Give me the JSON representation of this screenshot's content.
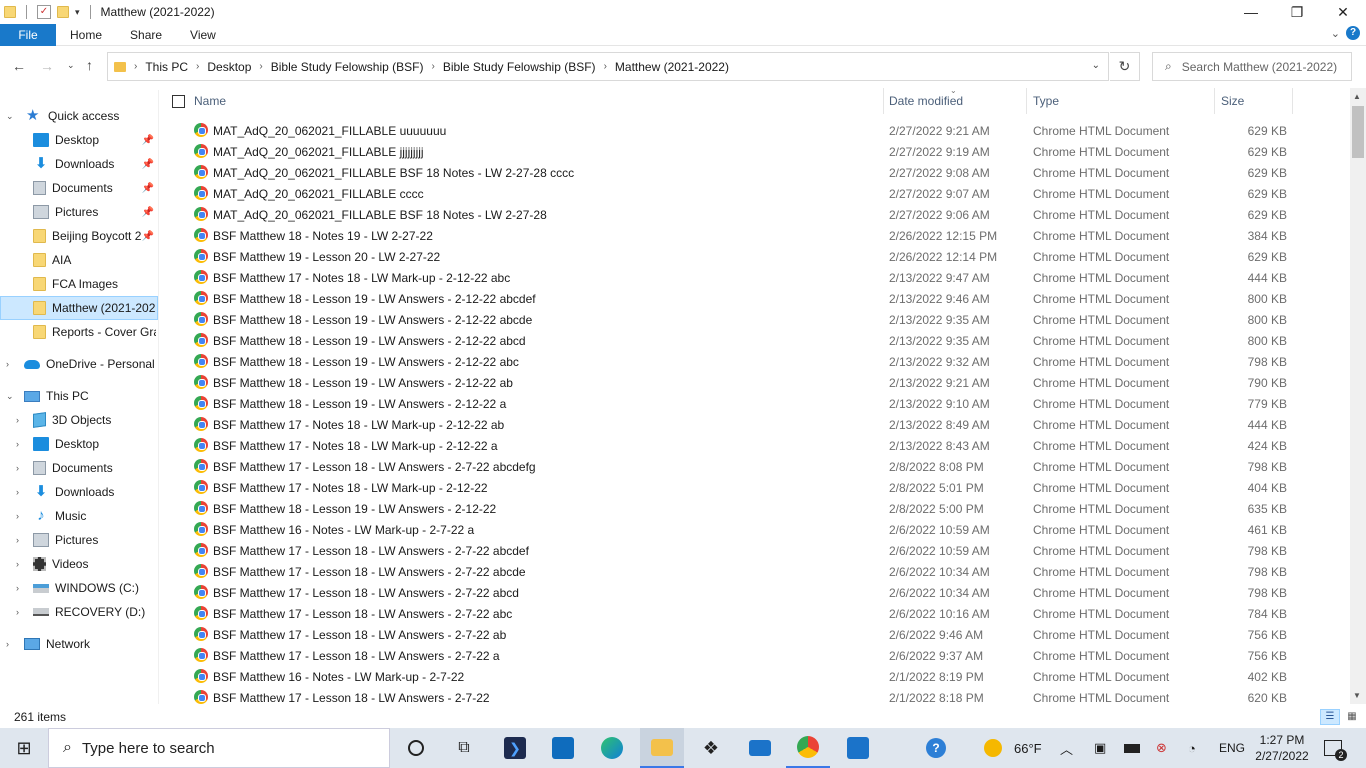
{
  "window": {
    "title": "Matthew (2021-2022)",
    "controls": [
      "—",
      "❐",
      "✕"
    ]
  },
  "ribbon": {
    "file": "File",
    "tabs": [
      "Home",
      "Share",
      "View"
    ]
  },
  "address": {
    "crumbs": [
      "This PC",
      "Desktop",
      "Bible Study Felowship (BSF)",
      "Bible Study Felowship (BSF)",
      "Matthew (2021-2022)"
    ],
    "search_placeholder": "Search Matthew (2021-2022)"
  },
  "sidebar": {
    "quick_access": "Quick access",
    "items": [
      {
        "label": "Desktop",
        "icon": "desktop-icon",
        "pinned": true
      },
      {
        "label": "Downloads",
        "icon": "download-arrow-icon",
        "pinned": true
      },
      {
        "label": "Documents",
        "icon": "documents-icon",
        "pinned": true
      },
      {
        "label": "Pictures",
        "icon": "pictures-icon",
        "pinned": true
      },
      {
        "label": "Beijing Boycott 2",
        "icon": "folder-icon",
        "pinned": true
      },
      {
        "label": "AIA",
        "icon": "folder-icon",
        "pinned": false
      },
      {
        "label": "FCA Images",
        "icon": "folder-icon",
        "pinned": false
      },
      {
        "label": "Matthew (2021-2022)",
        "icon": "folder-icon",
        "pinned": false,
        "selected": true
      },
      {
        "label": "Reports - Cover Gra",
        "icon": "folder-icon",
        "pinned": false
      }
    ],
    "onedrive": "OneDrive - Personal",
    "this_pc": "This PC",
    "pc_items": [
      {
        "label": "3D Objects",
        "icon": "3d-objects-icon"
      },
      {
        "label": "Desktop",
        "icon": "desktop-icon"
      },
      {
        "label": "Documents",
        "icon": "documents-icon"
      },
      {
        "label": "Downloads",
        "icon": "download-arrow-icon"
      },
      {
        "label": "Music",
        "icon": "music-icon"
      },
      {
        "label": "Pictures",
        "icon": "pictures-icon"
      },
      {
        "label": "Videos",
        "icon": "videos-icon"
      },
      {
        "label": "WINDOWS (C:)",
        "icon": "windows-drive-icon"
      },
      {
        "label": "RECOVERY (D:)",
        "icon": "drive-icon"
      }
    ],
    "network": "Network"
  },
  "columns": {
    "name": "Name",
    "date": "Date modified",
    "type": "Type",
    "size": "Size"
  },
  "files": [
    {
      "name": "MAT_AdQ_20_062021_FILLABLE uuuuuuu",
      "date": "2/27/2022 9:21 AM",
      "type": "Chrome HTML Document",
      "size": "629 KB"
    },
    {
      "name": "MAT_AdQ_20_062021_FILLABLE jjjjjjjjj",
      "date": "2/27/2022 9:19 AM",
      "type": "Chrome HTML Document",
      "size": "629 KB"
    },
    {
      "name": "MAT_AdQ_20_062021_FILLABLE BSF 18 Notes - LW 2-27-28 cccc",
      "date": "2/27/2022 9:08 AM",
      "type": "Chrome HTML Document",
      "size": "629 KB"
    },
    {
      "name": "MAT_AdQ_20_062021_FILLABLE cccc",
      "date": "2/27/2022 9:07 AM",
      "type": "Chrome HTML Document",
      "size": "629 KB"
    },
    {
      "name": "MAT_AdQ_20_062021_FILLABLE BSF 18 Notes - LW 2-27-28",
      "date": "2/27/2022 9:06 AM",
      "type": "Chrome HTML Document",
      "size": "629 KB"
    },
    {
      "name": "BSF Matthew 18 - Notes 19 - LW 2-27-22",
      "date": "2/26/2022 12:15 PM",
      "type": "Chrome HTML Document",
      "size": "384 KB"
    },
    {
      "name": "BSF Matthew 19 - Lesson 20 - LW 2-27-22",
      "date": "2/26/2022 12:14 PM",
      "type": "Chrome HTML Document",
      "size": "629 KB"
    },
    {
      "name": "BSF Matthew 17 - Notes 18 - LW Mark-up - 2-12-22 abc",
      "date": "2/13/2022 9:47 AM",
      "type": "Chrome HTML Document",
      "size": "444 KB"
    },
    {
      "name": "BSF Matthew 18 - Lesson 19 - LW Answers - 2-12-22 abcdef",
      "date": "2/13/2022 9:46 AM",
      "type": "Chrome HTML Document",
      "size": "800 KB"
    },
    {
      "name": "BSF Matthew 18 - Lesson 19 - LW Answers - 2-12-22 abcde",
      "date": "2/13/2022 9:35 AM",
      "type": "Chrome HTML Document",
      "size": "800 KB"
    },
    {
      "name": "BSF Matthew 18 - Lesson 19 - LW Answers - 2-12-22 abcd",
      "date": "2/13/2022 9:35 AM",
      "type": "Chrome HTML Document",
      "size": "800 KB"
    },
    {
      "name": "BSF Matthew 18 - Lesson 19 - LW Answers - 2-12-22 abc",
      "date": "2/13/2022 9:32 AM",
      "type": "Chrome HTML Document",
      "size": "798 KB"
    },
    {
      "name": "BSF Matthew 18 - Lesson 19 - LW Answers - 2-12-22 ab",
      "date": "2/13/2022 9:21 AM",
      "type": "Chrome HTML Document",
      "size": "790 KB"
    },
    {
      "name": "BSF Matthew 18 - Lesson 19 - LW Answers - 2-12-22 a",
      "date": "2/13/2022 9:10 AM",
      "type": "Chrome HTML Document",
      "size": "779 KB"
    },
    {
      "name": "BSF Matthew 17 - Notes 18 - LW Mark-up - 2-12-22 ab",
      "date": "2/13/2022 8:49 AM",
      "type": "Chrome HTML Document",
      "size": "444 KB"
    },
    {
      "name": "BSF Matthew 17 - Notes 18 - LW Mark-up - 2-12-22 a",
      "date": "2/13/2022 8:43 AM",
      "type": "Chrome HTML Document",
      "size": "424 KB"
    },
    {
      "name": "BSF Matthew 17 - Lesson 18 - LW Answers - 2-7-22 abcdefg",
      "date": "2/8/2022 8:08 PM",
      "type": "Chrome HTML Document",
      "size": "798 KB"
    },
    {
      "name": "BSF Matthew 17 - Notes 18 - LW Mark-up - 2-12-22",
      "date": "2/8/2022 5:01 PM",
      "type": "Chrome HTML Document",
      "size": "404 KB"
    },
    {
      "name": "BSF Matthew 18 - Lesson 19 - LW Answers - 2-12-22",
      "date": "2/8/2022 5:00 PM",
      "type": "Chrome HTML Document",
      "size": "635 KB"
    },
    {
      "name": "BSF Matthew 16 - Notes - LW Mark-up - 2-7-22 a",
      "date": "2/6/2022 10:59 AM",
      "type": "Chrome HTML Document",
      "size": "461 KB"
    },
    {
      "name": "BSF Matthew 17 - Lesson 18 - LW Answers - 2-7-22 abcdef",
      "date": "2/6/2022 10:59 AM",
      "type": "Chrome HTML Document",
      "size": "798 KB"
    },
    {
      "name": "BSF Matthew 17 - Lesson 18 - LW Answers - 2-7-22 abcde",
      "date": "2/6/2022 10:34 AM",
      "type": "Chrome HTML Document",
      "size": "798 KB"
    },
    {
      "name": "BSF Matthew 17 - Lesson 18 - LW Answers - 2-7-22 abcd",
      "date": "2/6/2022 10:34 AM",
      "type": "Chrome HTML Document",
      "size": "798 KB"
    },
    {
      "name": "BSF Matthew 17 - Lesson 18 - LW Answers - 2-7-22 abc",
      "date": "2/6/2022 10:16 AM",
      "type": "Chrome HTML Document",
      "size": "784 KB"
    },
    {
      "name": "BSF Matthew 17 - Lesson 18 - LW Answers - 2-7-22 ab",
      "date": "2/6/2022 9:46 AM",
      "type": "Chrome HTML Document",
      "size": "756 KB"
    },
    {
      "name": "BSF Matthew 17 - Lesson 18 - LW Answers - 2-7-22 a",
      "date": "2/6/2022 9:37 AM",
      "type": "Chrome HTML Document",
      "size": "756 KB"
    },
    {
      "name": "BSF Matthew 16 - Notes - LW Mark-up - 2-7-22",
      "date": "2/1/2022 8:19 PM",
      "type": "Chrome HTML Document",
      "size": "402 KB"
    },
    {
      "name": "BSF Matthew 17 - Lesson 18 - LW Answers - 2-7-22",
      "date": "2/1/2022 8:18 PM",
      "type": "Chrome HTML Document",
      "size": "620 KB"
    }
  ],
  "status": {
    "item_count": "261 items"
  },
  "taskbar": {
    "search_placeholder": "Type here to search",
    "weather_temp": "66°F",
    "language": "ENG",
    "time": "1:27 PM",
    "date": "2/27/2022",
    "notification_count": "2"
  },
  "colors": {
    "accent": "#1979ca",
    "selection": "#cce8ff",
    "folder": "#f8d775"
  }
}
